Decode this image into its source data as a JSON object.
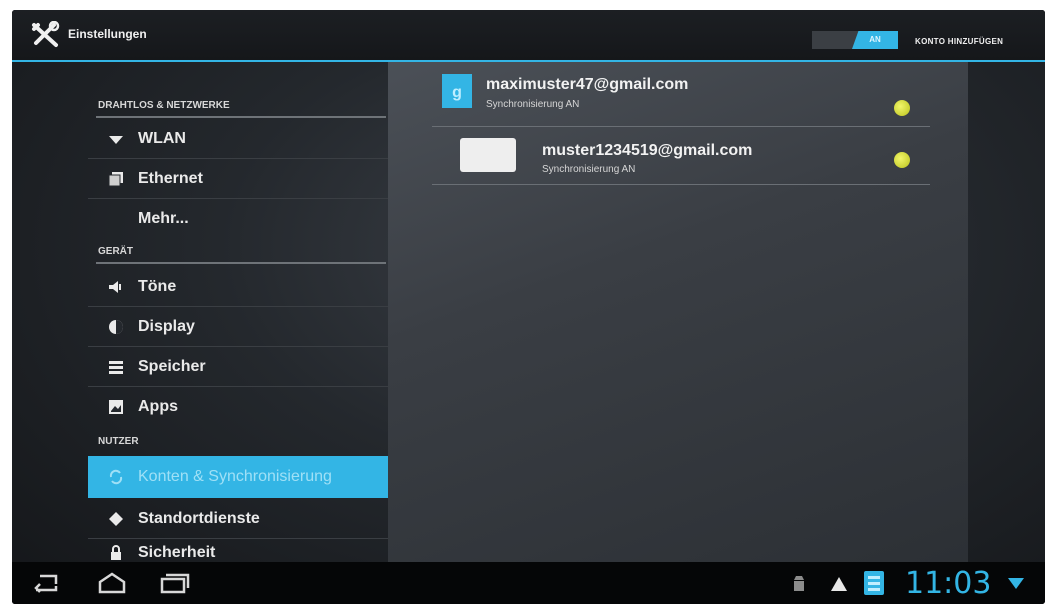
{
  "app": {
    "title": "Einstellungen"
  },
  "header": {
    "sync_toggle_label": "AN",
    "add_account_label": "KONTO HINZUFÜGEN"
  },
  "sidebar": {
    "sections": [
      {
        "title": "DRAHTLOS & NETZWERKE",
        "items": [
          {
            "label": "WLAN",
            "icon": "wifi-icon"
          },
          {
            "label": "Ethernet",
            "icon": "ethernet-icon"
          },
          {
            "label": "Mehr...",
            "icon": ""
          }
        ]
      },
      {
        "title": "GERÄT",
        "items": [
          {
            "label": "Töne",
            "icon": "speaker-icon"
          },
          {
            "label": "Display",
            "icon": "display-icon"
          },
          {
            "label": "Speicher",
            "icon": "storage-icon"
          },
          {
            "label": "Apps",
            "icon": "apps-icon"
          }
        ]
      },
      {
        "title": "NUTZER",
        "items": [
          {
            "label": "Konten & Synchronisierung",
            "icon": "sync-icon",
            "active": true
          },
          {
            "label": "Standortdienste",
            "icon": "location-icon"
          },
          {
            "label": "Sicherheit",
            "icon": "lock-icon"
          }
        ]
      }
    ]
  },
  "accounts": [
    {
      "email": "maximuster47@gmail.com",
      "status": "Synchronisierung AN",
      "icon": "google-icon"
    },
    {
      "email": "muster1234519@gmail.com",
      "status": "Synchronisierung AN",
      "icon": "email-account-icon"
    }
  ],
  "statusbar": {
    "time": "11:03"
  },
  "colors": {
    "accent": "#33b5e5",
    "sync_dot": "#d9e033",
    "background": "#1a1d21"
  }
}
